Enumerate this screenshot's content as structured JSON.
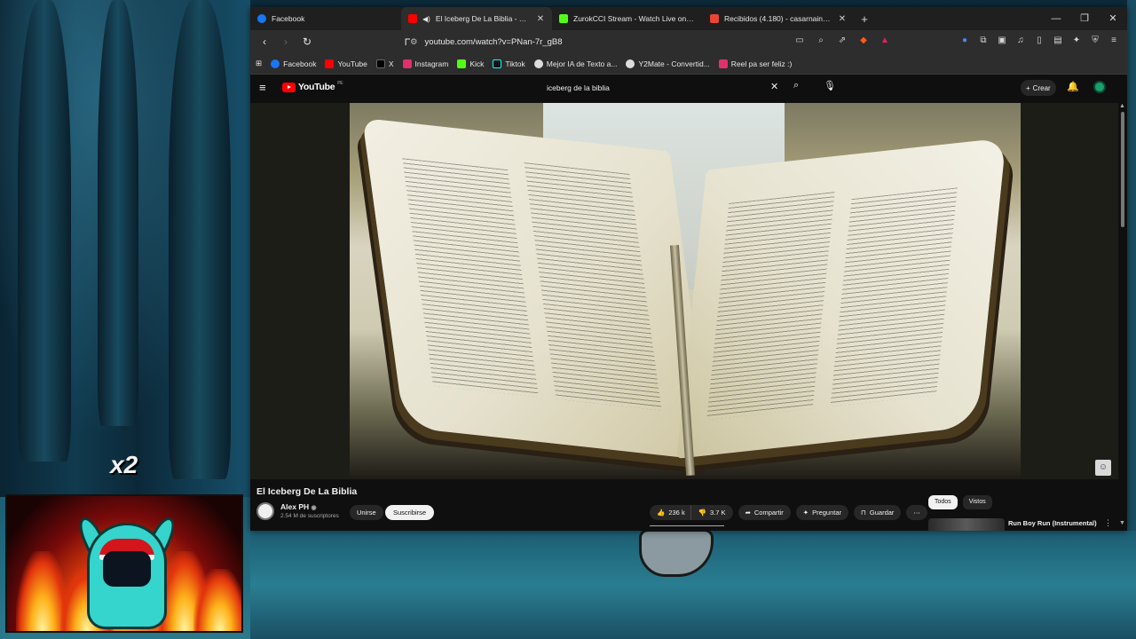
{
  "overlay": {
    "multiplier_text": "x2"
  },
  "browser": {
    "tabs": [
      {
        "title": "Facebook",
        "color": "#1877f2",
        "active": false
      },
      {
        "title": "El Iceberg De La Biblia - YouT",
        "color": "#ff0000",
        "active": true
      },
      {
        "title": "ZurokCCI Stream - Watch Live on Kic",
        "color": "#53fc18",
        "active": false
      },
      {
        "title": "Recibidos (4.180) - casarnainciocarlos",
        "color": "#ea4335",
        "active": false
      }
    ],
    "url": "youtube.com/watch?v=PNan-7r_gB8",
    "bookmarks": [
      {
        "label": "Facebook",
        "color": "#1877f2"
      },
      {
        "label": "YouTube",
        "color": "#ff0000"
      },
      {
        "label": "X",
        "color": "#000000"
      },
      {
        "label": "Instagram",
        "color": "#e1306c"
      },
      {
        "label": "Kick",
        "color": "#53fc18"
      },
      {
        "label": "Tiktok",
        "color": "#111111"
      },
      {
        "label": "Mejor IA de Texto a...",
        "color": "#dddddd"
      },
      {
        "label": "Y2Mate - Convertid...",
        "color": "#dddddd"
      },
      {
        "label": "Reel pa ser feliz :)",
        "color": "#e1306c"
      }
    ]
  },
  "youtube": {
    "logo_text": "YouTube",
    "logo_region": "PE",
    "search_query": "iceberg de la biblia",
    "create_label": "Crear",
    "video_title": "El Iceberg De La Biblia",
    "channel_name": "Alex PH",
    "channel_subs": "2.54 M de suscriptores",
    "join_label": "Unirse",
    "subscribe_label": "Suscribirse",
    "likes": "236 k",
    "dislikes": "3.7 K",
    "share_label": "Compartir",
    "ask_label": "Preguntar",
    "save_label": "Guardar",
    "chips": [
      "Todos",
      "Vistos"
    ],
    "rec_title": "Run Boy Run (Instrumental)"
  }
}
